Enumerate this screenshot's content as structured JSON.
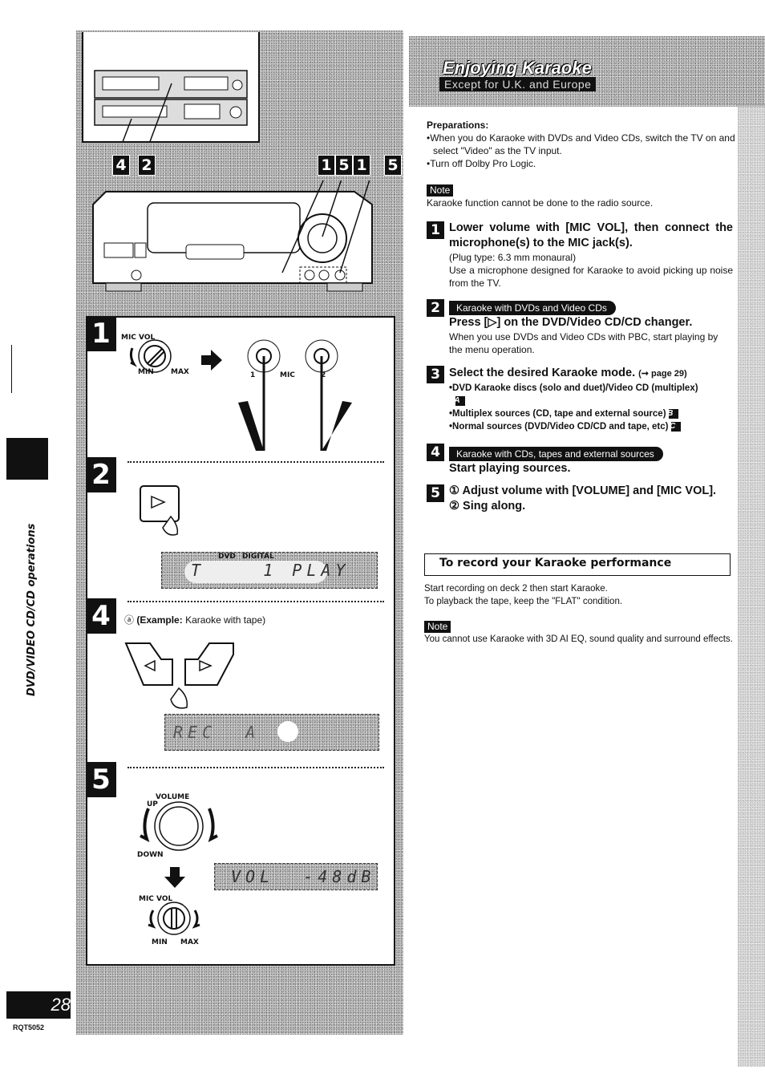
{
  "header": {
    "title": "Enjoying Karaoke",
    "subtitle": "Except for U.K. and Europe"
  },
  "preparations": {
    "label": "Preparations:",
    "items": [
      "When you do Karaoke with DVDs and Video CDs, switch the TV on and select \"Video\" as the TV input.",
      "Turn off Dolby Pro Logic."
    ]
  },
  "note1": {
    "tag": "Note",
    "text": "Karaoke function cannot be done to the radio source."
  },
  "steps": [
    {
      "number": "1",
      "heading": "Lower volume with [MIC VOL], then connect the microphone(s) to the MIC jack(s).",
      "lines": [
        "(Plug type: 6.3 mm monaural)",
        "Use a microphone designed for Karaoke to avoid picking up noise from the TV."
      ]
    },
    {
      "number": "2",
      "condition": "Karaoke with DVDs and Video CDs",
      "heading": "Press [▷] on the DVD/Video CD/CD changer.",
      "lines": [
        "When you use DVDs and Video CDs with PBC, start playing by the menu operation."
      ]
    },
    {
      "number": "3",
      "heading": "Select the desired Karaoke mode.",
      "ref": "(➞ page 29)",
      "bullets": [
        {
          "text": "DVD Karaoke discs (solo and duet)/Video CD (multiplex)",
          "tag": "A"
        },
        {
          "text": "Multiplex sources (CD, tape and external source)",
          "tag": "B"
        },
        {
          "text": "Normal sources (DVD/Video CD/CD and tape, etc)",
          "tag": "C"
        }
      ]
    },
    {
      "number": "4",
      "condition": "Karaoke with CDs, tapes and external sources",
      "heading": "Start playing sources."
    },
    {
      "number": "5",
      "sub1": "① Adjust volume with [VOLUME] and [MIC VOL].",
      "sub2": "② Sing along."
    }
  ],
  "record": {
    "title": "To record your Karaoke performance",
    "lines": [
      "Start recording on deck 2 then start Karaoke.",
      "To playback the tape, keep the \"FLAT\" condition."
    ]
  },
  "note2": {
    "tag": "Note",
    "text": "You cannot use Karaoke with 3D AI EQ, sound quality and surround effects."
  },
  "figure": {
    "top_callouts": [
      "4",
      "2"
    ],
    "unit_callouts": [
      "1",
      "5",
      "1",
      "5"
    ],
    "sections": {
      "s1": {
        "badge": "1",
        "mic_vol": "MIC VOL",
        "min": "MIN",
        "max": "MAX",
        "jack1": "1",
        "mic": "MIC",
        "jack2": "2"
      },
      "s2": {
        "badge": "2",
        "lcd_dvd": "DVD",
        "lcd_digital": "DIGITAL",
        "lcd_text": "T    1 PLAY"
      },
      "s4": {
        "badge": "4",
        "example_prefix": "ⓐ",
        "example_label": "(Example:",
        "example_text": "Karaoke with tape)",
        "lcd_text": "REC  A"
      },
      "s5": {
        "badge": "5",
        "volume": "VOLUME",
        "up": "UP",
        "down": "DOWN",
        "mic_vol": "MIC VOL",
        "min": "MIN",
        "max": "MAX",
        "lcd_text": "VOL  -48dB"
      }
    }
  },
  "sidebar": {
    "section_label": "DVD/VIDEO CD/CD operations",
    "page_number": "28",
    "doc_code": "RQT5052"
  }
}
